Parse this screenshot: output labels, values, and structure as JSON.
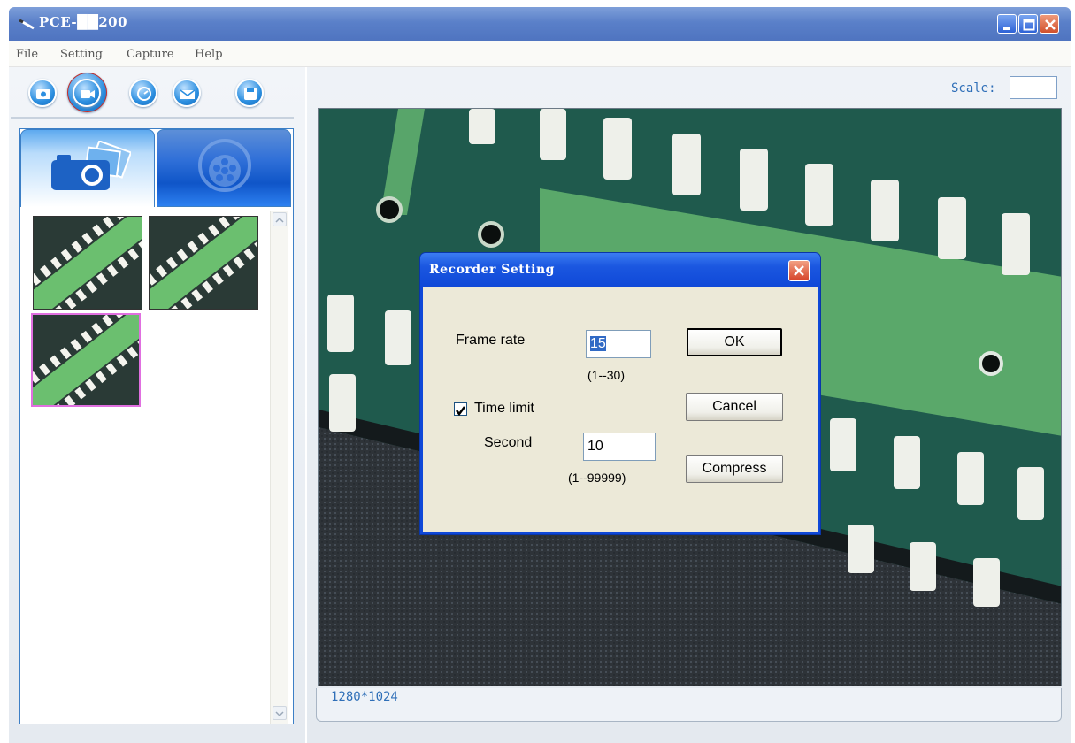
{
  "window": {
    "title": "PCE-██200",
    "controls": [
      "minimize",
      "maximize",
      "close"
    ]
  },
  "menu": {
    "items": [
      {
        "label": "File"
      },
      {
        "label": "Setting"
      },
      {
        "label": "Capture"
      },
      {
        "label": "Help"
      }
    ]
  },
  "toolbar": {
    "buttons": [
      {
        "icon": "photo-capture-icon"
      },
      {
        "icon": "video-record-icon",
        "active": true
      },
      {
        "icon": "timer-icon"
      },
      {
        "icon": "email-icon"
      },
      {
        "icon": "save-icon"
      }
    ]
  },
  "gallery": {
    "tabs": [
      {
        "icon": "camera-photos-icon",
        "selected": true
      },
      {
        "icon": "film-reel-icon",
        "selected": false
      }
    ],
    "thumbnails": 3,
    "selected_thumbnail": 3
  },
  "viewer": {
    "scale_label": "Scale:",
    "scale_value": "",
    "resolution": "1280*1024"
  },
  "dialog": {
    "title": "Recorder Setting",
    "frame_rate_label": "Frame rate",
    "frame_rate_value": "15",
    "frame_rate_range": "(1--30)",
    "time_limit_label": "Time limit",
    "time_limit_checked": true,
    "second_label": "Second",
    "second_value": "10",
    "second_range": "(1--99999)",
    "ok_label": "OK",
    "cancel_label": "Cancel",
    "compress_label": "Compress"
  },
  "colors": {
    "title_bar": "#5a80c9",
    "dialog_title": "#1b57e0",
    "dialog_body": "#ece9d8",
    "accent_text": "#2f6fb8"
  }
}
